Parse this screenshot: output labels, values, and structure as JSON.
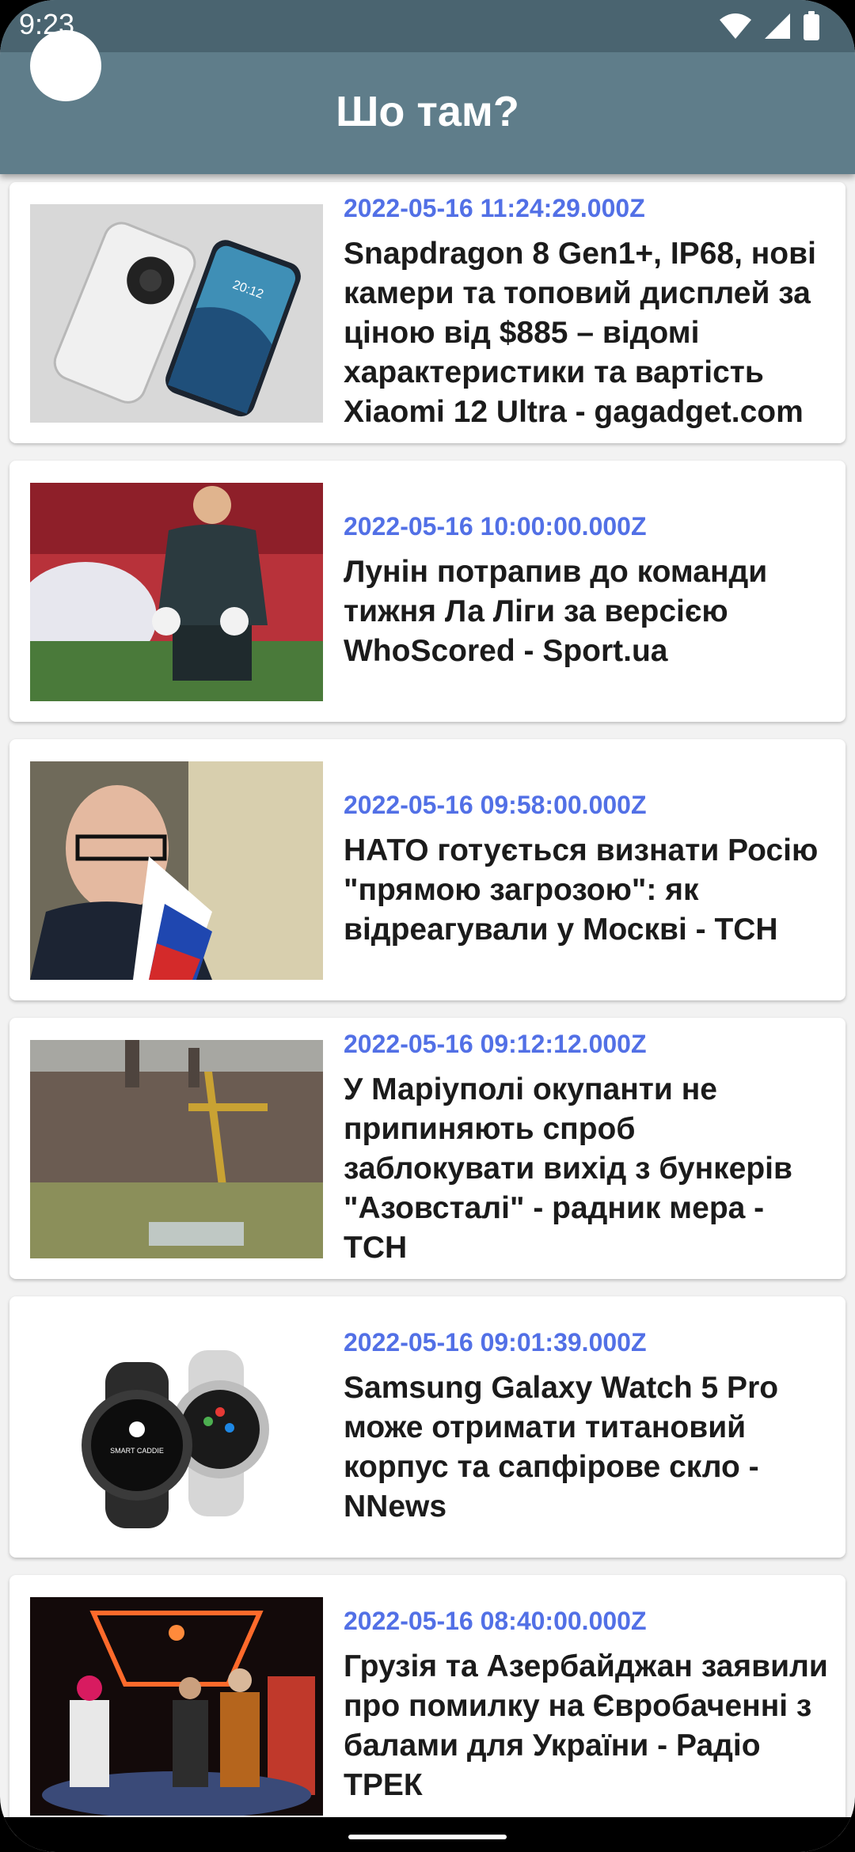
{
  "status_bar": {
    "time": "9:23",
    "icons": [
      "wifi-icon",
      "cell-signal-icon",
      "battery-icon"
    ]
  },
  "app_bar": {
    "title": "Шо там?"
  },
  "colors": {
    "app_bar": "#5f7d8a",
    "status_bar": "#4a6470",
    "date_accent": "#5270e6",
    "card_bg": "#ffffff",
    "list_bg": "#f2f2f2"
  },
  "articles": [
    {
      "date": "2022-05-16 11:24:29.000Z",
      "title": "Snapdragon 8 Gen1+, IP68, нові камери та топовий дисплей за ціною від $885 – відомі характеристики та вартість Xiaomi 12 Ultra - gagadget.com",
      "image": "phone-photo"
    },
    {
      "date": "2022-05-16 10:00:00.000Z",
      "title": "Лунін потрапив до команди тижня Ла Ліги за версією WhoScored - Sport.ua",
      "image": "goalkeeper-photo"
    },
    {
      "date": "2022-05-16 09:58:00.000Z",
      "title": "НАТО готується визнати Росію \"прямою загрозою\": як відреагували у Москві - ТСН",
      "image": "diplomat-photo"
    },
    {
      "date": "2022-05-16 09:12:12.000Z",
      "title": "У Маріуполі окупанти не припиняють спроб заблокувати вихід з бункерів \"Азовсталі\" - радник мера - ТСН",
      "image": "steel-plant-photo"
    },
    {
      "date": "2022-05-16 09:01:39.000Z",
      "title": "Samsung Galaxy Watch 5 Pro може отримати титановий корпус та сапфірове скло - NNews",
      "image": "smartwatch-photo",
      "image_text": "SMART CADDIE"
    },
    {
      "date": "2022-05-16 08:40:00.000Z",
      "title": "Грузія та Азербайджан заявили про помилку на Євробаченні з балами для України - Радіо ТРЕК",
      "image": "stage-performance-photo"
    }
  ]
}
